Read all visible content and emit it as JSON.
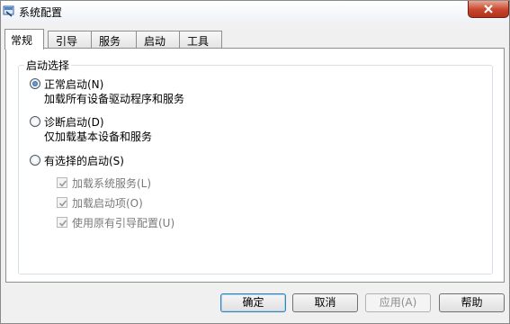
{
  "window": {
    "title": "系统配置",
    "icons": {
      "app": "msconfig-icon",
      "close": "close-icon"
    }
  },
  "tabs": [
    {
      "label": "常规",
      "active": true
    },
    {
      "label": "引导",
      "active": false
    },
    {
      "label": "服务",
      "active": false
    },
    {
      "label": "启动",
      "active": false
    },
    {
      "label": "工具",
      "active": false
    }
  ],
  "startup": {
    "group_title": "启动选择",
    "normal": {
      "label": "正常启动(N)",
      "description": "加载所有设备驱动程序和服务",
      "selected": true
    },
    "diagnostic": {
      "label": "诊断启动(D)",
      "description": "仅加载基本设备和服务",
      "selected": false
    },
    "selective": {
      "label": "有选择的启动(S)",
      "selected": false,
      "options": [
        {
          "label": "加载系统服务(L)",
          "checked": true,
          "enabled": false
        },
        {
          "label": "加载启动项(O)",
          "checked": true,
          "enabled": false
        },
        {
          "label": "使用原有引导配置(U)",
          "checked": true,
          "enabled": false
        }
      ]
    }
  },
  "buttons": {
    "ok": "确定",
    "cancel": "取消",
    "apply": "应用(A)",
    "help": "帮助"
  },
  "colors": {
    "accent": "#3c7fb1",
    "close_button": "#c7452c",
    "panel_border": "#8e8f8f"
  }
}
